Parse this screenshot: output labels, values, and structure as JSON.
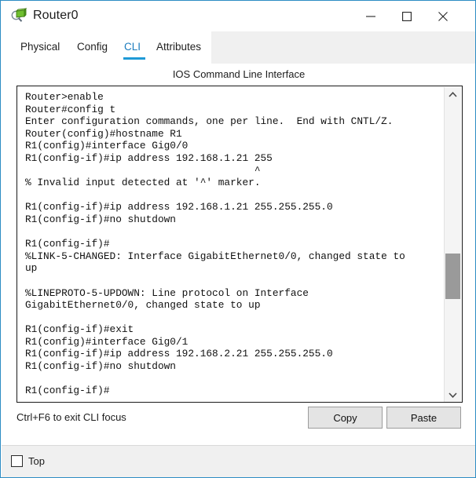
{
  "window": {
    "title": "Router0",
    "icon": "router-device-icon",
    "accent_color": "#1f9ad6",
    "controls": [
      {
        "name": "minimize",
        "glyph": "minimize-icon"
      },
      {
        "name": "maximize",
        "glyph": "maximize-icon"
      },
      {
        "name": "close",
        "glyph": "close-icon"
      }
    ]
  },
  "tabs": {
    "items": [
      {
        "label": "Physical",
        "selected": false
      },
      {
        "label": "Config",
        "selected": false
      },
      {
        "label": "CLI",
        "selected": true
      },
      {
        "label": "Attributes",
        "selected": false
      }
    ]
  },
  "panel": {
    "heading": "IOS Command Line Interface",
    "hint": "Ctrl+F6 to exit CLI focus",
    "buttons": {
      "copy": "Copy",
      "paste": "Paste"
    }
  },
  "terminal": {
    "lines": [
      "Router>enable",
      "Router#config t",
      "Enter configuration commands, one per line.  End with CNTL/Z.",
      "Router(config)#hostname R1",
      "R1(config)#interface Gig0/0",
      "R1(config-if)#ip address 192.168.1.21 255",
      "                                      ^",
      "% Invalid input detected at '^' marker.",
      "",
      "R1(config-if)#ip address 192.168.1.21 255.255.255.0",
      "R1(config-if)#no shutdown",
      "",
      "R1(config-if)#",
      "%LINK-5-CHANGED: Interface GigabitEthernet0/0, changed state to",
      "up",
      "",
      "%LINEPROTO-5-UPDOWN: Line protocol on Interface",
      "GigabitEthernet0/0, changed state to up",
      "",
      "R1(config-if)#exit",
      "R1(config)#interface Gig0/1",
      "R1(config-if)#ip address 192.168.2.21 255.255.255.0",
      "R1(config-if)#no shutdown",
      "",
      "R1(config-if)#"
    ]
  },
  "scrollbar": {
    "up_arrow": "chevron-up-icon",
    "down_arrow": "chevron-down-icon",
    "thumb_color": "#9a9a9a"
  },
  "bottom_bar": {
    "top_checkbox_label": "Top",
    "top_checkbox_checked": false
  }
}
